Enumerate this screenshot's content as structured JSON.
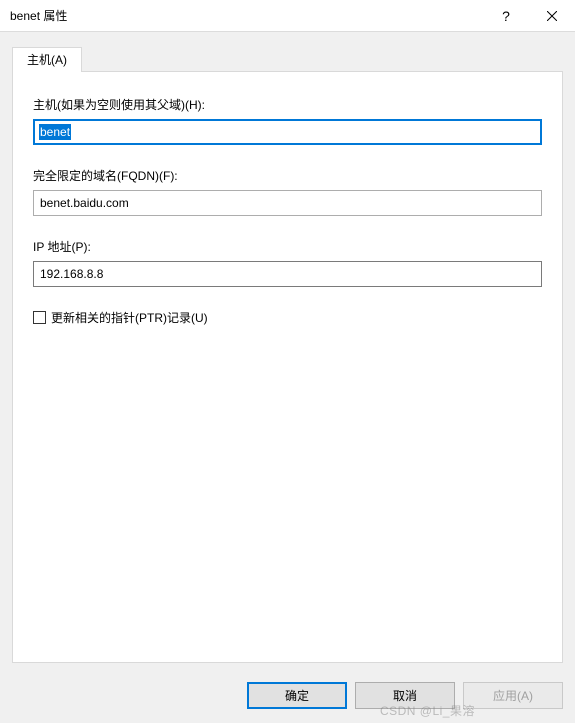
{
  "titlebar": {
    "title": "benet 属性",
    "help": "?",
    "close": "✕"
  },
  "tab": {
    "label": "主机(A)"
  },
  "form": {
    "host": {
      "label": "主机(如果为空则使用其父域)(H):",
      "value": "benet"
    },
    "fqdn": {
      "label": "完全限定的域名(FQDN)(F):",
      "value": "benet.baidu.com"
    },
    "ip": {
      "label": "IP 地址(P):",
      "value": "192.168.8.8"
    },
    "ptr": {
      "label": "更新相关的指针(PTR)记录(U)",
      "checked": false
    }
  },
  "buttons": {
    "ok": "确定",
    "cancel": "取消",
    "apply": "应用(A)"
  },
  "watermark": "CSDN @Li_果溶"
}
